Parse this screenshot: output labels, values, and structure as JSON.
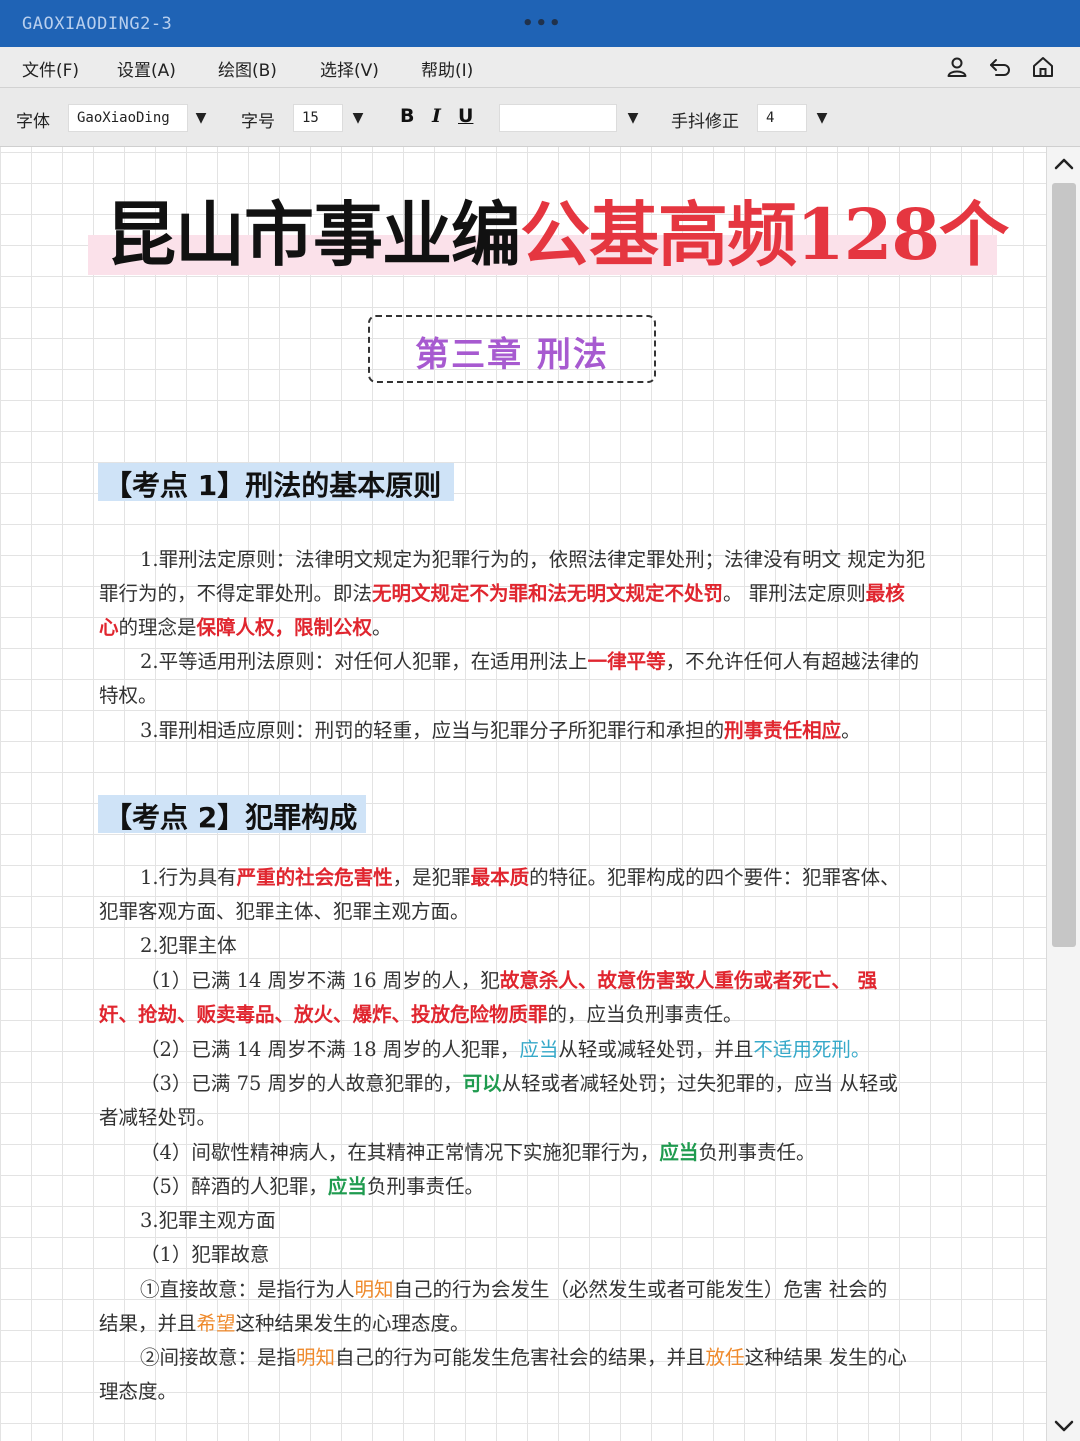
{
  "window": {
    "title": "GAOXIAODING2-3",
    "dots": "•••"
  },
  "menu": {
    "file": "文件(F)",
    "settings": "设置(A)",
    "draw": "绘图(B)",
    "select": "选择(V)",
    "help": "帮助(I)"
  },
  "toolbar": {
    "font_label": "字体",
    "font_value": "GaoXiaoDing",
    "size_label": "字号",
    "size_value": "15",
    "bold": "B",
    "italic": "I",
    "underline": "U",
    "blank_value": "",
    "stabilizer_label": "手抖修正",
    "stabilizer_value": "4"
  },
  "doc": {
    "title_black": "昆山市事业编",
    "title_red": "公基高频128个",
    "chapter": "第三章 刑法",
    "kp1": "【考点 1】刑法的基本原则",
    "p1": {
      "l1": "1.罪刑法定原则：法律明文规定为犯罪行为的，依照法律定罪处刑；法律没有明文 规定为犯",
      "l2a": "罪行为的，不得定罪处刑。即法",
      "l2b": "无明文规定不为罪和法无明文规定不处罚",
      "l2c": "。 罪刑法定原则",
      "l2d": "最核",
      "l3a": "心",
      "l3b": "的理念是",
      "l3c": "保障人权，限制公权",
      "l3d": "。",
      "l4a": "2.平等适用刑法原则：对任何人犯罪，在适用刑法上",
      "l4b": "一律平等",
      "l4c": "，不允许任何人有超越法律的",
      "l5": "特权。",
      "l6a": "3.罪刑相适应原则：刑罚的轻重，应当与犯罪分子所犯罪行和承担的",
      "l6b": "刑事责任相应",
      "l6c": "。"
    },
    "kp2": "【考点 2】犯罪构成",
    "p2": {
      "l1a": "1.行为具有",
      "l1b": "严重的社会危害性",
      "l1c": "，是犯罪",
      "l1d": "最本质",
      "l1e": "的特征。犯罪构成的四个要件：犯罪客体、",
      "l2": "犯罪客观方面、犯罪主体、犯罪主观方面。",
      "l3": "2.犯罪主体",
      "l4a": "（1）已满 14 周岁不满 16 周岁的人，犯",
      "l4b": "故意杀人、故意伤害致人重伤或者死亡、 强",
      "l5a": "奸、抢劫、贩卖毒品、放火、爆炸、投放危险物质罪",
      "l5b": "的，应当负刑事责任。",
      "l6a": "（2）已满 14 周岁不满 18 周岁的人犯罪，",
      "l6b": "应当",
      "l6c": "从轻或减轻处罚，并且",
      "l6d": "不适用死刑。",
      "l7a": "（3）已满 75 周岁的人故意犯罪的，",
      "l7b": "可以",
      "l7c": "从轻或者减轻处罚；过失犯罪的，应当 从轻或",
      "l8": "者减轻处罚。",
      "l9a": "（4）间歇性精神病人，在其精神正常情况下实施犯罪行为，",
      "l9b": "应当",
      "l9c": "负刑事责任。",
      "l10a": "（5）醉酒的人犯罪，",
      "l10b": "应当",
      "l10c": "负刑事责任。",
      "l11": "3.犯罪主观方面",
      "l12": "（1）犯罪故意",
      "l13a": "①直接故意：是指行为人",
      "l13b": "明知",
      "l13c": "自己的行为会发生（必然发生或者可能发生）危害 社会的",
      "l14a": "结果，并且",
      "l14b": "希望",
      "l14c": "这种结果发生的心理态度。",
      "l15a": "②间接故意：是指",
      "l15b": "明知",
      "l15c": "自己的行为可能发生危害社会的结果，并且",
      "l15d": "放任",
      "l15e": "这种结果 发生的心",
      "l16": "理态度。"
    }
  },
  "colors": {
    "titlebar": "#1f63b5",
    "accent_red": "#e0262f",
    "chapter_purple": "#a75ad0",
    "highlight_blue": "#cfe3f7",
    "title_highlight": "#fbe1ea"
  },
  "icons": [
    "user-icon",
    "undo-icon",
    "home-icon",
    "dropdown-arrow-icon",
    "scroll-up-icon",
    "scroll-down-icon"
  ]
}
